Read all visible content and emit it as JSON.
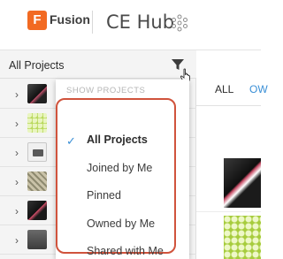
{
  "header": {
    "logo_letter": "F",
    "app_name": "Fusion",
    "hub_name": "CE Hub",
    "hub_icon": "hub-network-icon",
    "logo_color": "#f26a22"
  },
  "left_panel": {
    "title": "All Projects",
    "filter_icon": "filter-icon",
    "rows": [
      {
        "thumb": "dark-render"
      },
      {
        "thumb": "green-mesh"
      },
      {
        "thumb": "printer"
      },
      {
        "thumb": "grid-mesh"
      },
      {
        "thumb": "dark-render-2"
      },
      {
        "thumb": "grey-part"
      }
    ]
  },
  "right_area": {
    "tab_all": "ALL",
    "tab_owned": "OW"
  },
  "filter_menu": {
    "heading": "SHOW PROJECTS",
    "selected": "All Projects",
    "items": [
      "All Projects",
      "Joined by Me",
      "Pinned",
      "Owned by Me",
      "Shared with Me"
    ],
    "highlight_color": "#d0533c",
    "check_color": "#3a8fd6"
  }
}
